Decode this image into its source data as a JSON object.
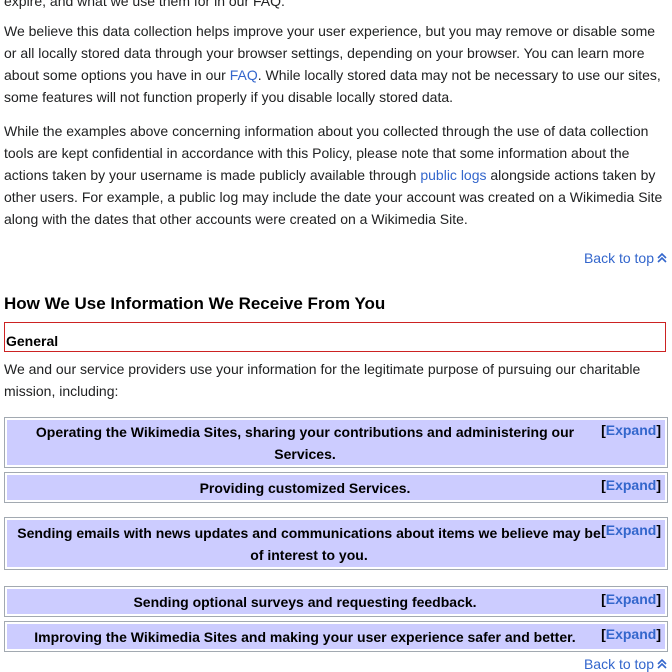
{
  "fragment_top": "expire, and what we use them for in our FAQ.",
  "paragraph1": {
    "before_link": "We believe this data collection helps improve your user experience, but you may remove or disable some or all locally stored data through your browser settings, depending on your browser. You can learn more about some options you have in our ",
    "link": "FAQ",
    "after_link": ". While locally stored data may not be necessary to use our sites, some features will not function properly if you disable locally stored data."
  },
  "paragraph2": {
    "before_link": "While the examples above concerning information about you collected through the use of data collection tools are kept confidential in accordance with this Policy, please note that some information about the actions taken by your username is made publicly available through ",
    "link": "public logs",
    "after_link": " alongside actions taken by other users. For example, a public log may include the date your account was created on a Wikimedia Site along with the dates that other accounts were created on a Wikimedia Site."
  },
  "back_to_top": "Back to top",
  "section_heading": "How We Use Information We Receive From You",
  "subsection": "General",
  "intro": "We and our service providers use your information for the legitimate purpose of pursuing our charitable mission, including:",
  "expand_label": "Expand",
  "collapsibles": [
    {
      "title": "Operating the Wikimedia Sites, sharing your contributions and administering our Services."
    },
    {
      "title": "Providing customized Services."
    },
    {
      "title": "Sending emails with news updates and communications about items we believe may be of interest to you."
    },
    {
      "title": "Sending optional surveys and requesting feedback."
    },
    {
      "title": "Improving the Wikimedia Sites and making your user experience safer and better."
    }
  ],
  "colors": {
    "link": "#3366cc",
    "collapsible_bg": "#ccccff",
    "focus_border": "#cc2222"
  }
}
